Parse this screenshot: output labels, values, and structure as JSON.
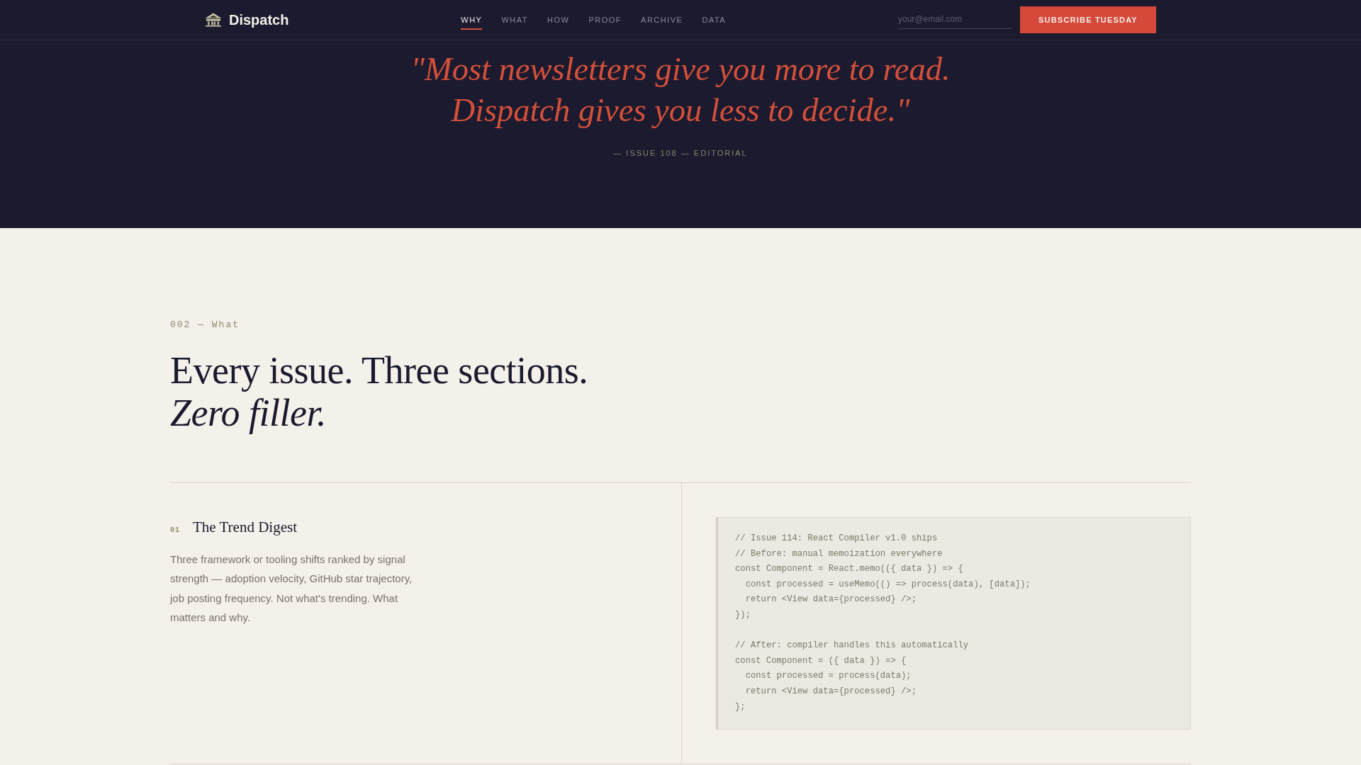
{
  "header": {
    "brand": "Dispatch",
    "nav": [
      {
        "label": "WHY",
        "selected": true
      },
      {
        "label": "WHAT",
        "selected": false
      },
      {
        "label": "HOW",
        "selected": false
      },
      {
        "label": "PROOF",
        "selected": false
      },
      {
        "label": "ARCHIVE",
        "selected": false
      },
      {
        "label": "DATA",
        "selected": false
      }
    ],
    "email_field": {
      "placeholder": "your@email.com"
    },
    "subscribe_button": "SUBSCRIBE TUESDAY"
  },
  "hero": {
    "quote": [
      "\"Most newsletters give you more to read.",
      "Dispatch gives you less to decide.\""
    ],
    "attribution": "— ISSUE 108 — EDITORIAL"
  },
  "section": {
    "label": "002 — What",
    "heading": [
      "Every issue. Three sections.",
      "*Zero filler.*"
    ],
    "features": [
      {
        "number": "01",
        "title": "The Trend Digest",
        "description": "Three framework or tooling shifts ranked by signal strength — adoption velocity, GitHub star trajectory, job posting frequency. Not what's trending. What matters and why.",
        "code": "// Issue 114: React Compiler v1.0 ships\n// Before: manual memoization everywhere\nconst Component = React.memo(({ data }) => {\n  const processed = useMemo(() => process(data), [data]);\n  return <View data={processed} />;\n});\n\n// After: compiler handles this automatically\nconst Component = ({ data }) => {\n  const processed = process(data);\n  return <View data={processed} />;\n};"
      }
    ]
  }
}
